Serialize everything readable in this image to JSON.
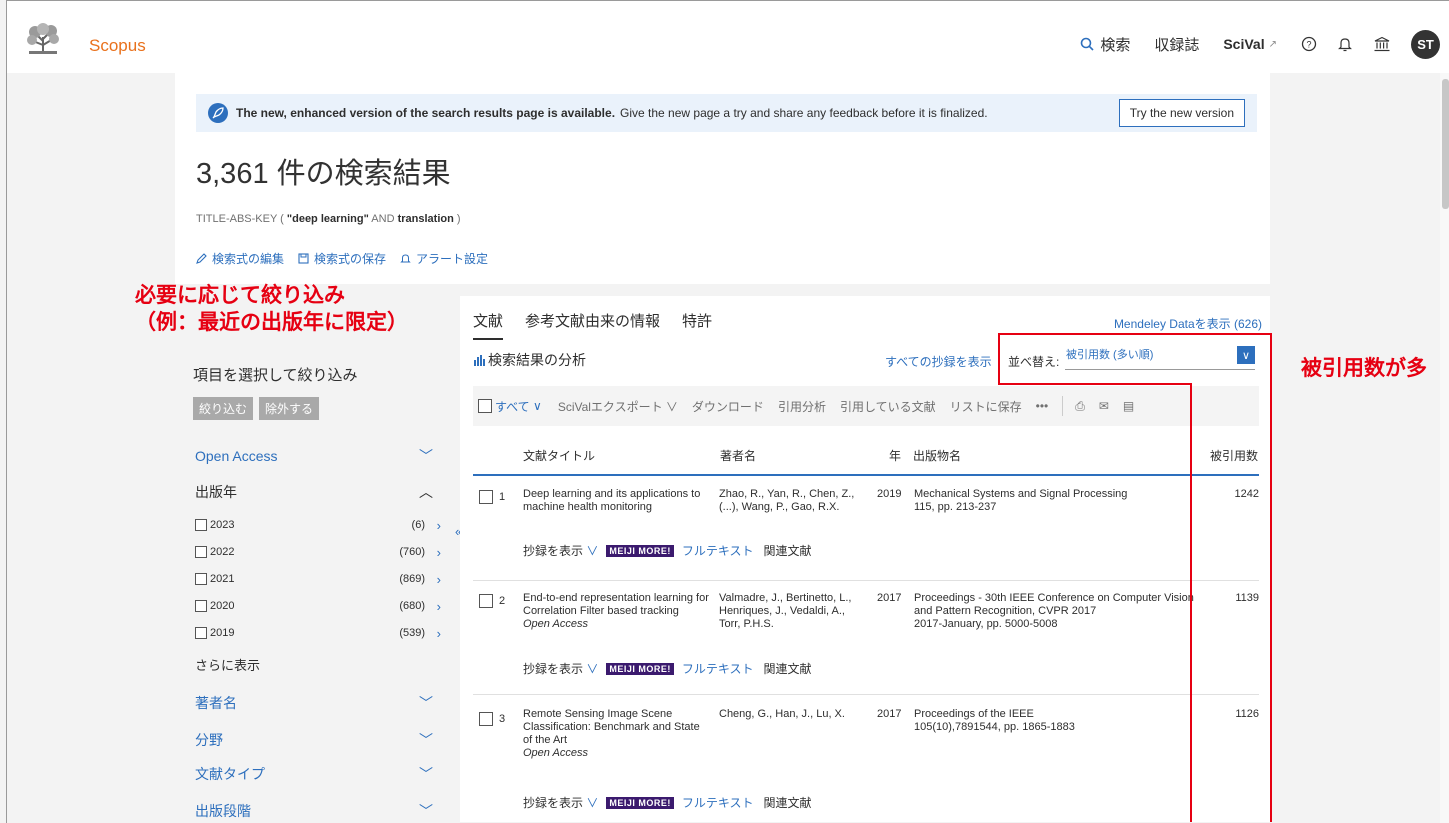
{
  "header": {
    "brand": "Scopus",
    "nav": {
      "search": "検索",
      "journals": "収録誌",
      "scival": "SciVal",
      "scival_ext": "↗",
      "avatar": "ST"
    }
  },
  "banner": {
    "bold": "The new, enhanced version of the search results page is available.",
    "text": "Give the new page a try and share any feedback before it is finalized.",
    "button": "Try the new version"
  },
  "results": {
    "title": "3,361 件の検索結果",
    "query": {
      "field": "TITLE-ABS-KEY (",
      "term1": "\"deep learning\"",
      "op": "AND",
      "term2": "translation",
      "close": ")"
    },
    "actions": [
      "検索式の編集",
      "検索式の保存",
      "アラート設定"
    ]
  },
  "annotations": {
    "left_line1": "必要に応じて絞り込み",
    "left_line2": "（例：最近の出版年に限定）",
    "right": "被引用数が多"
  },
  "sidebar": {
    "heading": "項目を選択して絞り込み",
    "btn_limit": "絞り込む",
    "btn_exclude": "除外する",
    "facets": {
      "open_access": "Open Access",
      "year": "出版年",
      "author": "著者名",
      "subject": "分野",
      "doctype": "文献タイプ",
      "stage": "出版段階"
    },
    "years": [
      {
        "year": "2023",
        "count": "(6)"
      },
      {
        "year": "2022",
        "count": "(760)"
      },
      {
        "year": "2021",
        "count": "(869)"
      },
      {
        "year": "2020",
        "count": "(680)"
      },
      {
        "year": "2019",
        "count": "(539)"
      }
    ],
    "more": "さらに表示"
  },
  "tabs": [
    "文献",
    "参考文献由来の情報",
    "特許"
  ],
  "mendeley": "Mendeley Dataを表示 (626)",
  "analyze": "検索結果の分析",
  "show_all_abstracts": "すべての抄録を表示",
  "sort": {
    "label": "並べ替え:",
    "value": "被引用数 (多い順)"
  },
  "toolbar": {
    "all": "すべて",
    "scival": "SciValエクスポート",
    "download": "ダウンロード",
    "citation": "引用分析",
    "citing": "引用している文献",
    "save": "リストに保存",
    "more": "•••"
  },
  "table": {
    "headers": {
      "title": "文献タイトル",
      "authors": "著者名",
      "year": "年",
      "source": "出版物名",
      "cited": "被引用数"
    },
    "links": {
      "abstract": "抄録を表示",
      "meiji": "MEIJI MORE!",
      "fulltext": "フルテキスト",
      "related": "関連文献"
    },
    "rows": [
      {
        "num": "1",
        "title": "Deep learning and its applications to machine health monitoring",
        "oa": "",
        "authors": "Zhao, R., Yan, R., Chen, Z., (...), Wang, P., Gao, R.X.",
        "year": "2019",
        "source": "Mechanical Systems and Signal Processing",
        "source2": "115, pp. 213-237",
        "cited": "1242"
      },
      {
        "num": "2",
        "title": "End-to-end representation learning for Correlation Filter based tracking",
        "oa": "Open Access",
        "authors": "Valmadre, J., Bertinetto, L., Henriques, J., Vedaldi, A., Torr, P.H.S.",
        "year": "2017",
        "source": "Proceedings - 30th IEEE Conference on Computer Vision and Pattern Recognition, CVPR 2017",
        "source2": "2017-January, pp. 5000-5008",
        "cited": "1139"
      },
      {
        "num": "3",
        "title": "Remote Sensing Image Scene Classification: Benchmark and State of the Art",
        "oa": "Open Access",
        "authors": "Cheng, G., Han, J., Lu, X.",
        "year": "2017",
        "source": "Proceedings of the IEEE",
        "source2": "105(10),7891544, pp. 1865-1883",
        "cited": "1126"
      }
    ]
  },
  "colors": {
    "accent": "#2d6fbd",
    "brand": "#e9711c",
    "annotation": "#e60012"
  }
}
